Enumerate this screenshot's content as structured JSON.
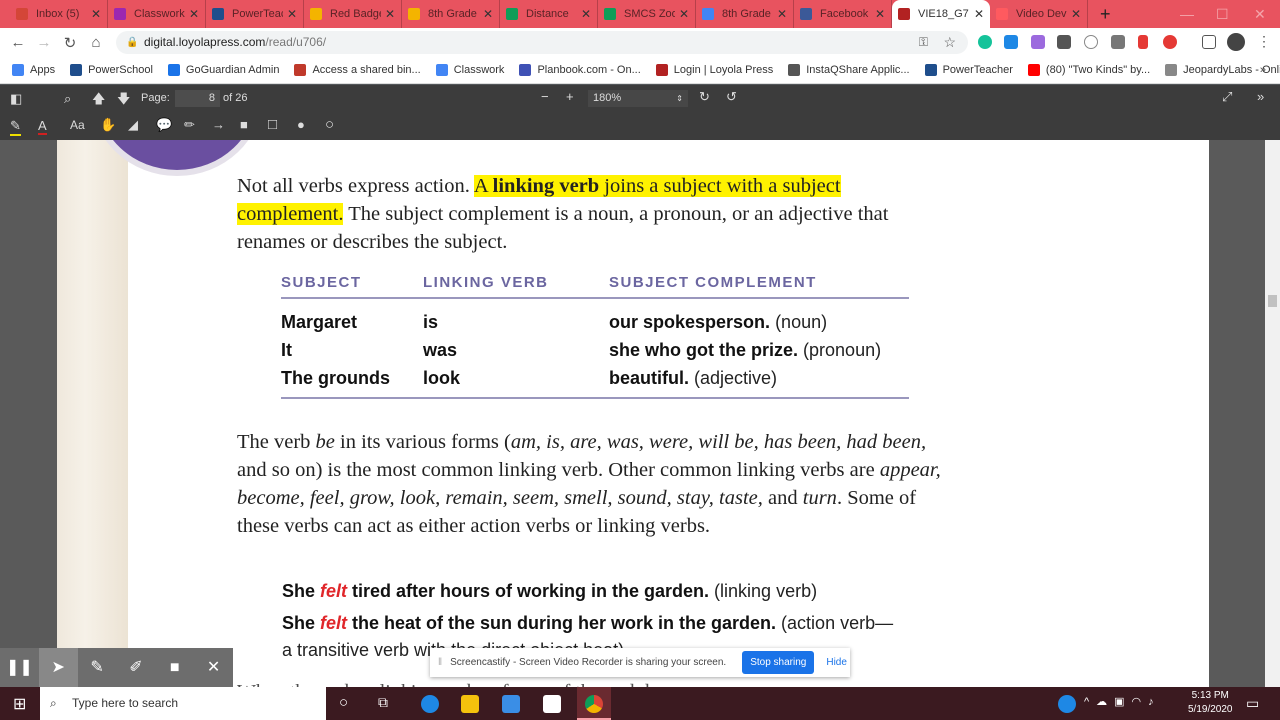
{
  "browser": {
    "tabs": [
      {
        "label": "Inbox (5)",
        "color": "#d44638"
      },
      {
        "label": "Classwork",
        "color": "#9c27b0"
      },
      {
        "label": "PowerTeacher",
        "color": "#1f4e8c"
      },
      {
        "label": "Red Badge",
        "color": "#f4b400"
      },
      {
        "label": "8th Grade",
        "color": "#f4b400"
      },
      {
        "label": "Distance",
        "color": "#0f9d58"
      },
      {
        "label": "SMCS Zoom",
        "color": "#0f9d58"
      },
      {
        "label": "8th Grade",
        "color": "#4285f4"
      },
      {
        "label": "Facebook",
        "color": "#3b5998"
      },
      {
        "label": "VIE18_G7",
        "color": "#b22222",
        "active": true
      },
      {
        "label": "Video Dev",
        "color": "#ff5a5f"
      }
    ],
    "url_host": "digital.loyolapress.com",
    "url_path": "/read/u706/",
    "bookmarks": [
      {
        "label": "Apps",
        "color": "#4285f4"
      },
      {
        "label": "PowerSchool",
        "color": "#1f4e8c"
      },
      {
        "label": "GoGuardian Admin",
        "color": "#1a73e8"
      },
      {
        "label": "Access a shared bin...",
        "color": "#c0392b"
      },
      {
        "label": "Classwork",
        "color": "#4285f4"
      },
      {
        "label": "Planbook.com - On...",
        "color": "#3f51b5"
      },
      {
        "label": "Login | Loyola Press",
        "color": "#b22222"
      },
      {
        "label": "InstaQShare Applic...",
        "color": "#555555"
      },
      {
        "label": "PowerTeacher",
        "color": "#1f4e8c"
      },
      {
        "label": "(80) \"Two Kinds\" by...",
        "color": "#ff0000"
      },
      {
        "label": "JeopardyLabs - Onli...",
        "color": "#888888"
      }
    ],
    "more": "»"
  },
  "pdf": {
    "page_label": "Page:",
    "page": "8",
    "of": "of 26",
    "zoom": "180%"
  },
  "doc": {
    "p1": [
      "Not all verbs express action. ",
      "A ",
      "linking verb",
      " joins a subject with a subject complement.",
      "",
      " The subject complement is a noun, a pronoun, or an adjective that renames or describes the subject."
    ],
    "table": {
      "headers": [
        "SUBJECT",
        "LINKING VERB",
        "SUBJECT COMPLEMENT"
      ],
      "rows": [
        {
          "subject": "Margaret",
          "verb": "is",
          "complement": "our spokesperson.",
          "type": "(noun)"
        },
        {
          "subject": "It",
          "verb": "was",
          "complement": "she who got the prize.",
          "type": "(pronoun)"
        },
        {
          "subject": "The grounds",
          "verb": "look",
          "complement": "beautiful.",
          "type": "(adjective)"
        }
      ]
    },
    "p2": [
      "The verb ",
      "be",
      " in its various forms (",
      "am, is, are, was, were, will be, has been, had been,",
      " and so on) is the most common linking verb. Other common linking verbs are ",
      "appear, become, feel, grow, look, remain, seem, smell, sound, stay, taste,",
      " and ",
      "turn",
      ". Some of these verbs can act as either action verbs or linking verbs."
    ],
    "examples": [
      {
        "pre": "She ",
        "verb": "felt",
        "post": " tired after hours of working in the garden.",
        "note": " (linking verb)"
      },
      {
        "pre": "She ",
        "verb": "felt",
        "post": " the heat of the sun during her work in the garden.",
        "note": " (action verb—"
      }
    ],
    "example_cont": "a transitive verb with the direct object heat)",
    "next_line": "When the verb ... linking verb ... forms of the verb be ..."
  },
  "screencastify": {
    "message": "Screencastify - Screen Video Recorder is sharing your screen.",
    "stop": "Stop sharing",
    "hide": "Hide"
  },
  "taskbar": {
    "search_placeholder": "Type here to search",
    "time": "5:13 PM",
    "date": "5/19/2020"
  }
}
